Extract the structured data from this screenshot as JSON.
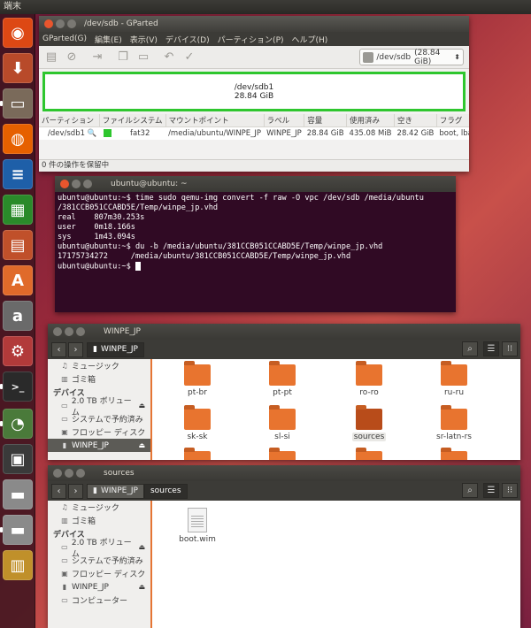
{
  "topbar": {
    "title": "端末"
  },
  "launcher": {
    "items": [
      {
        "name": "ubuntu-logo-icon",
        "glyph": "◉",
        "color": "#dd4814"
      },
      {
        "name": "installer-icon",
        "glyph": "⬇",
        "color": "#b84a2a"
      },
      {
        "name": "file-manager-icon",
        "glyph": "▭",
        "color": "#7a6a5a"
      },
      {
        "name": "firefox-icon",
        "glyph": "◍",
        "color": "#e66000"
      },
      {
        "name": "writer-icon",
        "glyph": "≡",
        "color": "#1e5fa8"
      },
      {
        "name": "calc-icon",
        "glyph": "▦",
        "color": "#2a8a2a"
      },
      {
        "name": "impress-icon",
        "glyph": "▤",
        "color": "#c0502a"
      },
      {
        "name": "software-center-icon",
        "glyph": "A",
        "color": "#e06a2a"
      },
      {
        "name": "amazon-icon",
        "glyph": "a",
        "color": "#6a6a6a"
      },
      {
        "name": "system-settings-icon",
        "glyph": "⚙",
        "color": "#b23a3a"
      },
      {
        "name": "terminal-icon",
        "glyph": ">_",
        "color": "#2a2a2a"
      },
      {
        "name": "gparted-icon",
        "glyph": "◔",
        "color": "#4a7a3a"
      },
      {
        "name": "floppy-icon",
        "glyph": "▣",
        "color": "#3a3a3a"
      },
      {
        "name": "drive-icon",
        "glyph": "▬",
        "color": "#8a8a8a"
      },
      {
        "name": "usb-drive-icon",
        "glyph": "▬",
        "color": "#8a8a8a"
      },
      {
        "name": "trash-icon",
        "glyph": "▥",
        "color": "#c0902a"
      }
    ]
  },
  "gparted": {
    "title": "/dev/sdb - GParted",
    "menu": [
      "GParted(G)",
      "編集(E)",
      "表示(V)",
      "デバイス(D)",
      "パーティション(P)",
      "ヘルプ(H)"
    ],
    "device": {
      "name": "/dev/sdb",
      "size": "(28.84 GiB)"
    },
    "map": {
      "partition": "/dev/sdb1",
      "size": "28.84 GiB"
    },
    "columns": [
      "パーティション",
      "ファイルシステム",
      "マウントポイント",
      "ラベル",
      "容量",
      "使用済み",
      "空き",
      "フラグ"
    ],
    "row": {
      "partition": "/dev/sdb1",
      "fs": "fat32",
      "mount": "/media/ubuntu/WINPE_JP",
      "label": "WINPE_JP",
      "size": "28.84 GiB",
      "used": "435.08 MiB",
      "free": "28.42 GiB",
      "flags": "boot, lba"
    },
    "status": "0 件の操作を保留中",
    "fs_color": "#2ec62e"
  },
  "terminal": {
    "title": "ubuntu@ubuntu: ~",
    "lines": [
      "ubuntu@ubuntu:~$ time sudo qemu-img convert -f raw -O vpc /dev/sdb /media/ubuntu",
      "/381CCB051CCABD5E/Temp/winpe_jp.vhd",
      "",
      "real    807m30.253s",
      "user    0m18.166s",
      "sys     1m43.094s",
      "ubuntu@ubuntu:~$ du -b /media/ubuntu/381CCB051CCABD5E/Temp/winpe_jp.vhd",
      "17175734272     /media/ubuntu/381CCB051CCABD5E/Temp/winpe_jp.vhd"
    ],
    "prompt": "ubuntu@ubuntu:~$ "
  },
  "fm1": {
    "title": "WINPE_JP",
    "crumb": "WINPE_JP",
    "sidebar": {
      "music": "ミュージック",
      "trash": "ゴミ箱",
      "devices_header": "デバイス",
      "volume": "2.0 TB ボリューム",
      "reserved": "システムで予約済み",
      "floppy": "フロッピー ディスク",
      "winpe": "WINPE_JP"
    },
    "folders": [
      "pt-br",
      "pt-pt",
      "ro-ro",
      "ru-ru",
      "sk-sk",
      "sl-si",
      "sources",
      "sr-latn-rs"
    ]
  },
  "fm2": {
    "title": "sources",
    "crumb_parent": "WINPE_JP",
    "crumb_current": "sources",
    "sidebar": {
      "music": "ミュージック",
      "trash": "ゴミ箱",
      "devices_header": "デバイス",
      "volume": "2.0 TB ボリューム",
      "reserved": "システムで予約済み",
      "floppy": "フロッピー ディスク",
      "winpe": "WINPE_JP",
      "computer": "コンピューター"
    },
    "file": "boot.wim"
  }
}
